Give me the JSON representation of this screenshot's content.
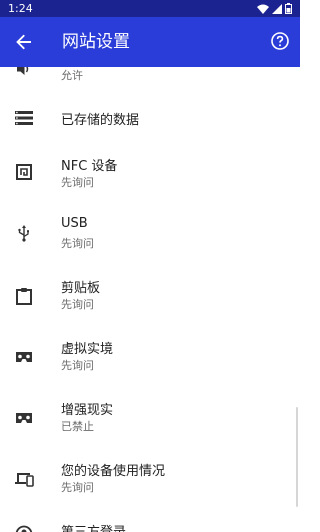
{
  "status_bar": {
    "time": "1:24",
    "icons": [
      "wifi-icon",
      "signal-icon",
      "battery-icon"
    ]
  },
  "app_bar": {
    "title": "网站设置",
    "back_icon": "arrow-back-icon",
    "help_icon": "help-icon"
  },
  "colors": {
    "status_bar": "#1a238f",
    "app_bar": "#2b3dd8",
    "icon": "#333333",
    "primary_text": "#212121",
    "secondary_text": "#6b6b6b"
  },
  "items": [
    {
      "icon": "volume-icon",
      "title": "",
      "subtitle": "允许"
    },
    {
      "icon": "storage-icon",
      "title": "已存储的数据",
      "subtitle": ""
    },
    {
      "icon": "nfc-icon",
      "title": "NFC 设备",
      "subtitle": "先询问"
    },
    {
      "icon": "usb-icon",
      "title": "USB",
      "subtitle": "先询问"
    },
    {
      "icon": "clipboard-icon",
      "title": "剪贴板",
      "subtitle": "先询问"
    },
    {
      "icon": "vr-headset-icon",
      "title": "虚拟实境",
      "subtitle": "先询问"
    },
    {
      "icon": "ar-headset-icon",
      "title": "增强现实",
      "subtitle": "已禁止"
    },
    {
      "icon": "devices-icon",
      "title": "您的设备使用情况",
      "subtitle": "先询问"
    },
    {
      "icon": "account-icon",
      "title": "第三方登录",
      "subtitle": ""
    }
  ]
}
